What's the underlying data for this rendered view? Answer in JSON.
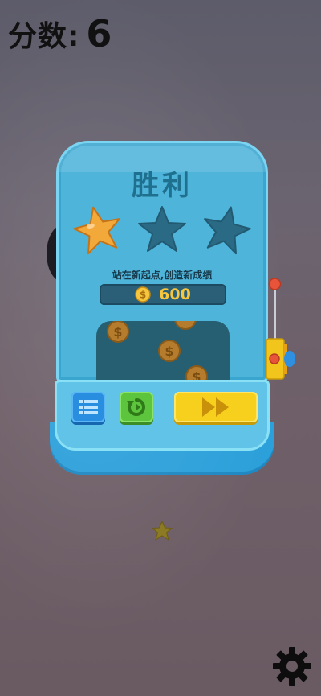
{
  "hud": {
    "score_label": "分数:",
    "score_value": "6"
  },
  "result_panel": {
    "title": "胜利",
    "stars_earned": 1,
    "stars_total": 3,
    "subtitle": "站在新起点,创造新成绩",
    "coins": "600"
  },
  "buttons": {
    "menu_icon": "list-icon",
    "retry_icon": "retry-icon",
    "next_icon": "fast-forward-icon"
  },
  "colors": {
    "panel": "#4fb4da",
    "star_earned": "#f3a83a",
    "star_empty": "#2a6a85",
    "coin": "#f5c63e",
    "menu_button": "#2a8ee0",
    "retry_button": "#5cc43d",
    "next_button": "#f7d01e"
  },
  "settings_icon": "gear-icon"
}
